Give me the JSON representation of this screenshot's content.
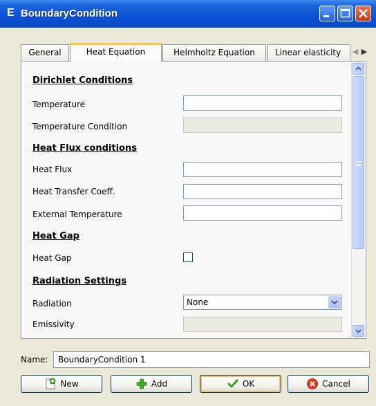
{
  "window": {
    "title": "BoundaryCondition",
    "app_icon_letter": "E"
  },
  "tabs": [
    {
      "label": "General",
      "active": false
    },
    {
      "label": "Heat Equation",
      "active": true
    },
    {
      "label": "Helmholtz Equation",
      "active": false
    },
    {
      "label": "Linear elasticity",
      "active": false
    }
  ],
  "form": {
    "dirichlet_header": "Dirichlet Conditions",
    "temperature_label": "Temperature",
    "temperature_value": "",
    "temperature_condition_label": "Temperature Condition",
    "heat_flux_header": "Heat Flux conditions",
    "heat_flux_label": "Heat Flux",
    "heat_flux_value": "",
    "heat_transfer_coeff_label": "Heat Transfer Coeff.",
    "heat_transfer_coeff_value": "",
    "external_temperature_label": "External Temperature",
    "external_temperature_value": "",
    "heat_gap_header": "Heat Gap",
    "heat_gap_label": "Heat Gap",
    "heat_gap_checked": false,
    "radiation_header": "Radiation Settings",
    "radiation_label": "Radiation",
    "radiation_value": "None",
    "emissivity_label": "Emissivity"
  },
  "name_field": {
    "label": "Name:",
    "value": "BoundaryCondition 1"
  },
  "buttons": {
    "new": "New",
    "add": "Add",
    "ok": "OK",
    "cancel": "Cancel"
  },
  "colors": {
    "titlebar": "#0a52d6",
    "active_tab_accent": "#ffc83c",
    "close_button": "#c5371a"
  }
}
